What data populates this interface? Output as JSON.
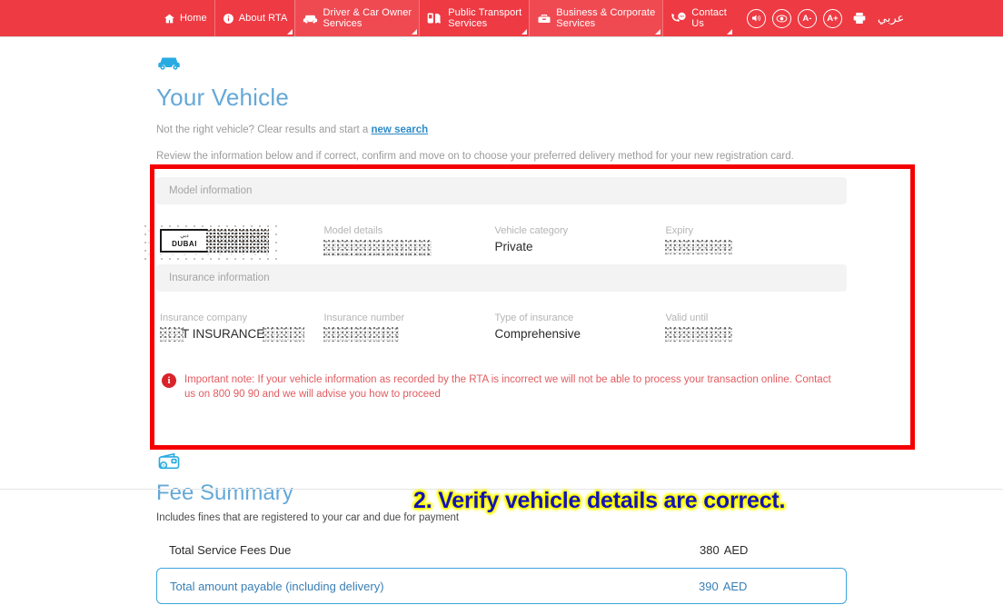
{
  "nav": {
    "items": [
      {
        "label": "Home",
        "label2": "",
        "icon": "home-icon",
        "shaded": false,
        "caret": false,
        "sep": false
      },
      {
        "label": "About RTA",
        "label2": "",
        "icon": "info-icon",
        "shaded": false,
        "caret": true,
        "sep": true
      },
      {
        "label": "Driver & Car Owner",
        "label2": "Services",
        "icon": "car-icon",
        "shaded": true,
        "caret": true,
        "sep": true
      },
      {
        "label": "Public Transport",
        "label2": "Services",
        "icon": "transport-icon",
        "shaded": false,
        "caret": true,
        "sep": true
      },
      {
        "label": "Business & Corporate",
        "label2": "Services",
        "icon": "briefcase-icon",
        "shaded": true,
        "caret": true,
        "sep": true
      },
      {
        "label": "Contact",
        "label2": "Us",
        "icon": "phone-chat-icon",
        "shaded": false,
        "caret": true,
        "sep": true
      }
    ],
    "tools": {
      "sound": "sound-icon",
      "contrast": "contrast-icon",
      "font_decrease": "A-",
      "font_increase": "A+",
      "print": "print-icon",
      "arabic": "عربي"
    },
    "bg_color": "#ee3a43"
  },
  "vehicle": {
    "icon": "car-icon",
    "title": "Your Vehicle",
    "not_right_prefix": "Not the right vehicle? Clear results and start a ",
    "new_search_link": "new search",
    "review_text": "Review the information below and if correct, confirm and move on to choose your preferred delivery method for your new registration card.",
    "model_band": "Model information",
    "insurance_band": "Insurance information",
    "fields_model": [
      {
        "label": "",
        "value": "",
        "redacted": true,
        "kind": "plate"
      },
      {
        "label": "Model details",
        "value": "",
        "redacted": true,
        "kind": "text"
      },
      {
        "label": "Vehicle category",
        "value": "Private",
        "redacted": false,
        "kind": "text"
      },
      {
        "label": "Expiry",
        "value": "",
        "redacted": true,
        "kind": "text"
      }
    ],
    "fields_insurance": [
      {
        "label": "Insurance company",
        "value": "T INSURANCE",
        "redacted": true,
        "kind": "partial"
      },
      {
        "label": "Insurance number",
        "value": "",
        "redacted": true,
        "kind": "text"
      },
      {
        "label": "Type of insurance",
        "value": "Comprehensive",
        "redacted": false,
        "kind": "text"
      },
      {
        "label": "Valid until",
        "value": "",
        "redacted": true,
        "kind": "text"
      }
    ],
    "plate": {
      "arabic": "دبي",
      "english": "DUBAI"
    },
    "note_icon": "info-circle-icon",
    "note_text": "Important note: If your vehicle information as recorded by the RTA is incorrect we will not be able to process your transaction online. Contact us on 800 90 90 and we will advise you how to proceed"
  },
  "fee": {
    "icon": "wallet-icon",
    "title": "Fee Summary",
    "subtitle": "Includes fines that are registered to your car and due for payment",
    "rows": [
      {
        "name": "Total Service Fees Due",
        "amount": "380",
        "currency": "AED",
        "highlighted": false
      },
      {
        "name": "Total amount payable (including delivery)",
        "amount": "390",
        "currency": "AED",
        "highlighted": true
      }
    ]
  },
  "annotation": {
    "callout": "2. Verify vehicle details are correct.",
    "callout_color": "#1414b4",
    "callout_glow": "#ffff00",
    "box_color": "#f50000"
  }
}
